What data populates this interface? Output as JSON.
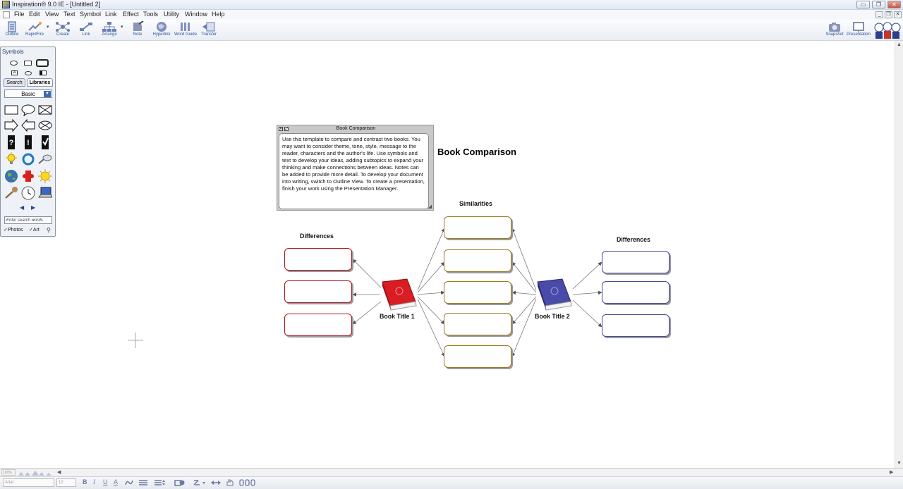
{
  "window": {
    "title": "Inspiration® 9.0 IE - [Untitled 2]",
    "min_glyph": "▭",
    "max_glyph": "❐",
    "close_glyph": "✕"
  },
  "menu": {
    "items": [
      "File",
      "Edit",
      "View",
      "Text",
      "Symbol",
      "Link",
      "Effect",
      "Tools",
      "Utility",
      "Window",
      "Help"
    ]
  },
  "toolbar": {
    "outline": "Outline",
    "rapidfire": "RapidFire",
    "create": "Create",
    "link": "Link",
    "arrange": "Arrange",
    "note": "Note",
    "hyperlink": "Hyperlink",
    "word_guide": "Word Guide",
    "transfer": "Transfer",
    "snapshot": "Snapshot",
    "presentation": "Presentation"
  },
  "symbols_palette": {
    "title": "Symbols",
    "tab_search": "Search",
    "tab_libraries": "Libraries",
    "library_selected": "Basic",
    "search_placeholder": "Enter search words",
    "photos_label": "Photos",
    "art_label": "Art",
    "nav_prev": "◀",
    "nav_next": "▶",
    "library_icons": [
      "rectangle-icon",
      "speech-bubble-icon",
      "crossed-box-icon",
      "arrow-right-icon",
      "arrow-left-icon",
      "crossed-oval-icon",
      "question-icon",
      "exclamation-icon",
      "checkmark-icon",
      "lightbulb-icon",
      "recycle-icon",
      "magnifier-icon",
      "globe-icon",
      "puzzle-icon",
      "sun-icon",
      "key-icon",
      "clock-icon",
      "laptop-icon"
    ]
  },
  "note": {
    "title": "Book Comparison",
    "body": "Use this template to compare and contrast two books. You may want to consider theme, tone, style, message to the reader, characters and the author's life. Use symbols and text to develop your ideas, adding subtopics to expand your thinking and make connections between ideas. Notes can be added to provide more detail. To develop your document into writing, switch to Outline View. To create a presentation, finish your work using the Presentation Manager."
  },
  "diagram": {
    "main_title": "Book Comparison",
    "left_label": "Differences",
    "middle_label": "Similarities",
    "right_label": "Differences",
    "book1": "Book Title 1",
    "book2": "Book Title 2",
    "colors": {
      "book1": "#d91d22",
      "book2": "#4a4aa8",
      "left_boxes": "#b0151c",
      "middle_boxes": "#9c7a1e",
      "right_boxes": "#454aa0"
    }
  },
  "statusbar": {
    "zoom": "100%",
    "font": "Arial",
    "size": "12",
    "bold": "B",
    "italic": "I",
    "underline": "U",
    "text_color": "A"
  }
}
